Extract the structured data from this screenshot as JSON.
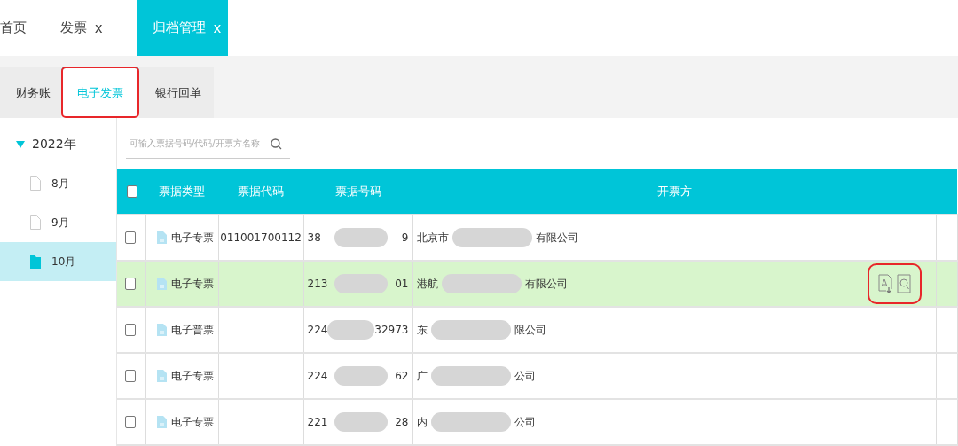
{
  "top_tabs": [
    {
      "label": "首页",
      "selected": false
    },
    {
      "label": "发票",
      "close": "x",
      "selected": false
    },
    {
      "label": "归档管理",
      "close": "x",
      "selected": true
    }
  ],
  "sub_tabs": [
    {
      "label": "财务账",
      "selected": false,
      "annotated": false
    },
    {
      "label": "电子发票",
      "selected": true,
      "annotated": true
    },
    {
      "label": "银行回单",
      "selected": false,
      "annotated": false
    }
  ],
  "tree": [
    {
      "label": "2022年",
      "expanded": true,
      "children": [
        {
          "label": "8月",
          "selected": false
        },
        {
          "label": "9月",
          "selected": false
        },
        {
          "label": "10月",
          "selected": true
        }
      ]
    }
  ],
  "search": {
    "placeholder": "可输入票据号码/代码/开票方名称"
  },
  "table": {
    "header_checked": false,
    "columns": [
      "票据类型",
      "票据代码",
      "票据号码",
      "开票方"
    ],
    "rows": [
      {
        "checked": false,
        "selected": false,
        "type": "电子专票",
        "code": "011001700112",
        "number": {
          "start": "38",
          "end": "9"
        },
        "issuer": {
          "start": "北京市",
          "end": "有限公司"
        },
        "actions": false
      },
      {
        "checked": false,
        "selected": true,
        "type": "电子专票",
        "number": {
          "start": "213",
          "end": "01"
        },
        "issuer": {
          "start": "港航",
          "end": "有限公司"
        },
        "actions": true,
        "actions_annotated": true
      },
      {
        "checked": false,
        "selected": false,
        "type": "电子普票",
        "number": {
          "start": "224",
          "end": "32973"
        },
        "issuer": {
          "start": "东",
          "end": "限公司"
        },
        "actions": false
      },
      {
        "checked": false,
        "selected": false,
        "type": "电子专票",
        "number": {
          "start": "224",
          "end": "62"
        },
        "issuer": {
          "start": "广",
          "end": "公司"
        },
        "actions": false
      },
      {
        "checked": false,
        "selected": false,
        "type": "电子专票",
        "number": {
          "start": "221",
          "end": "28"
        },
        "issuer": {
          "start": "内",
          "end": "公司"
        },
        "actions": false
      }
    ]
  }
}
